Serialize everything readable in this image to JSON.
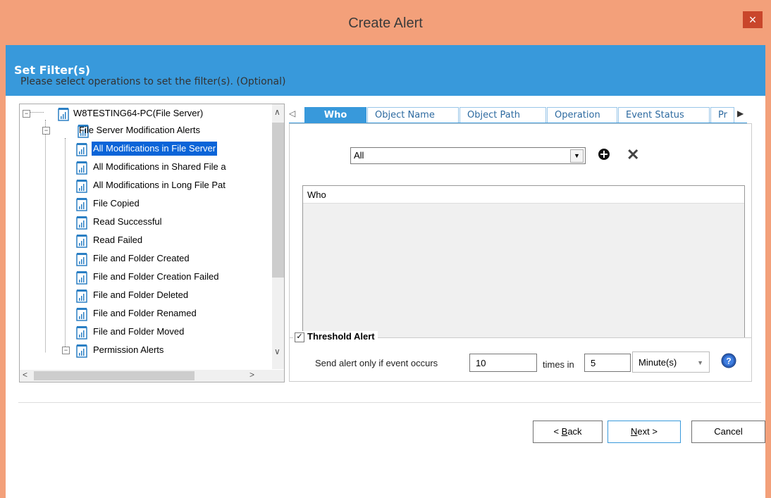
{
  "window": {
    "title": "Create Alert",
    "close_glyph": "×"
  },
  "header": {
    "title": "Set Filter(s)"
  },
  "instruction": "Please select operations to set the filter(s). (Optional)",
  "tree": {
    "items": [
      {
        "label": "W8TESTING64-PC(File Server)"
      },
      {
        "label": "File Server Modification Alerts"
      },
      {
        "label": "All Modifications in File Server"
      },
      {
        "label": "All Modifications in Shared File a"
      },
      {
        "label": "All Modifications in Long File Pat"
      },
      {
        "label": "File Copied"
      },
      {
        "label": "Read Successful"
      },
      {
        "label": "Read Failed"
      },
      {
        "label": "File and Folder Created"
      },
      {
        "label": "File and Folder Creation Failed"
      },
      {
        "label": "File and Folder Deleted"
      },
      {
        "label": "File and Folder Renamed"
      },
      {
        "label": "File and Folder Moved"
      },
      {
        "label": "Permission Alerts"
      }
    ],
    "selected_label": "All Modifications in File Server"
  },
  "tabs": [
    {
      "label": "Who"
    },
    {
      "label": "Object Name"
    },
    {
      "label": "Object Path"
    },
    {
      "label": "Operation"
    },
    {
      "label": "Event Status"
    },
    {
      "label": "Pr"
    }
  ],
  "filter": {
    "combo_value": "All",
    "grid_header": "Who"
  },
  "threshold": {
    "title": "Threshold Alert",
    "checked": true,
    "send_label": "Send alert only if event occurs",
    "count_value": "10",
    "times_in_label": "times in",
    "period_value": "5",
    "unit_value": "Minute(s)"
  },
  "buttons": {
    "back_prefix": "< ",
    "back_key": "B",
    "back_rest": "ack",
    "next_key": "N",
    "next_rest": "ext >",
    "cancel": "Cancel"
  },
  "colors": {
    "accent": "#3899db",
    "titlebar": "#f3a07a",
    "selection": "#0a64d8",
    "close": "#c9462b"
  }
}
